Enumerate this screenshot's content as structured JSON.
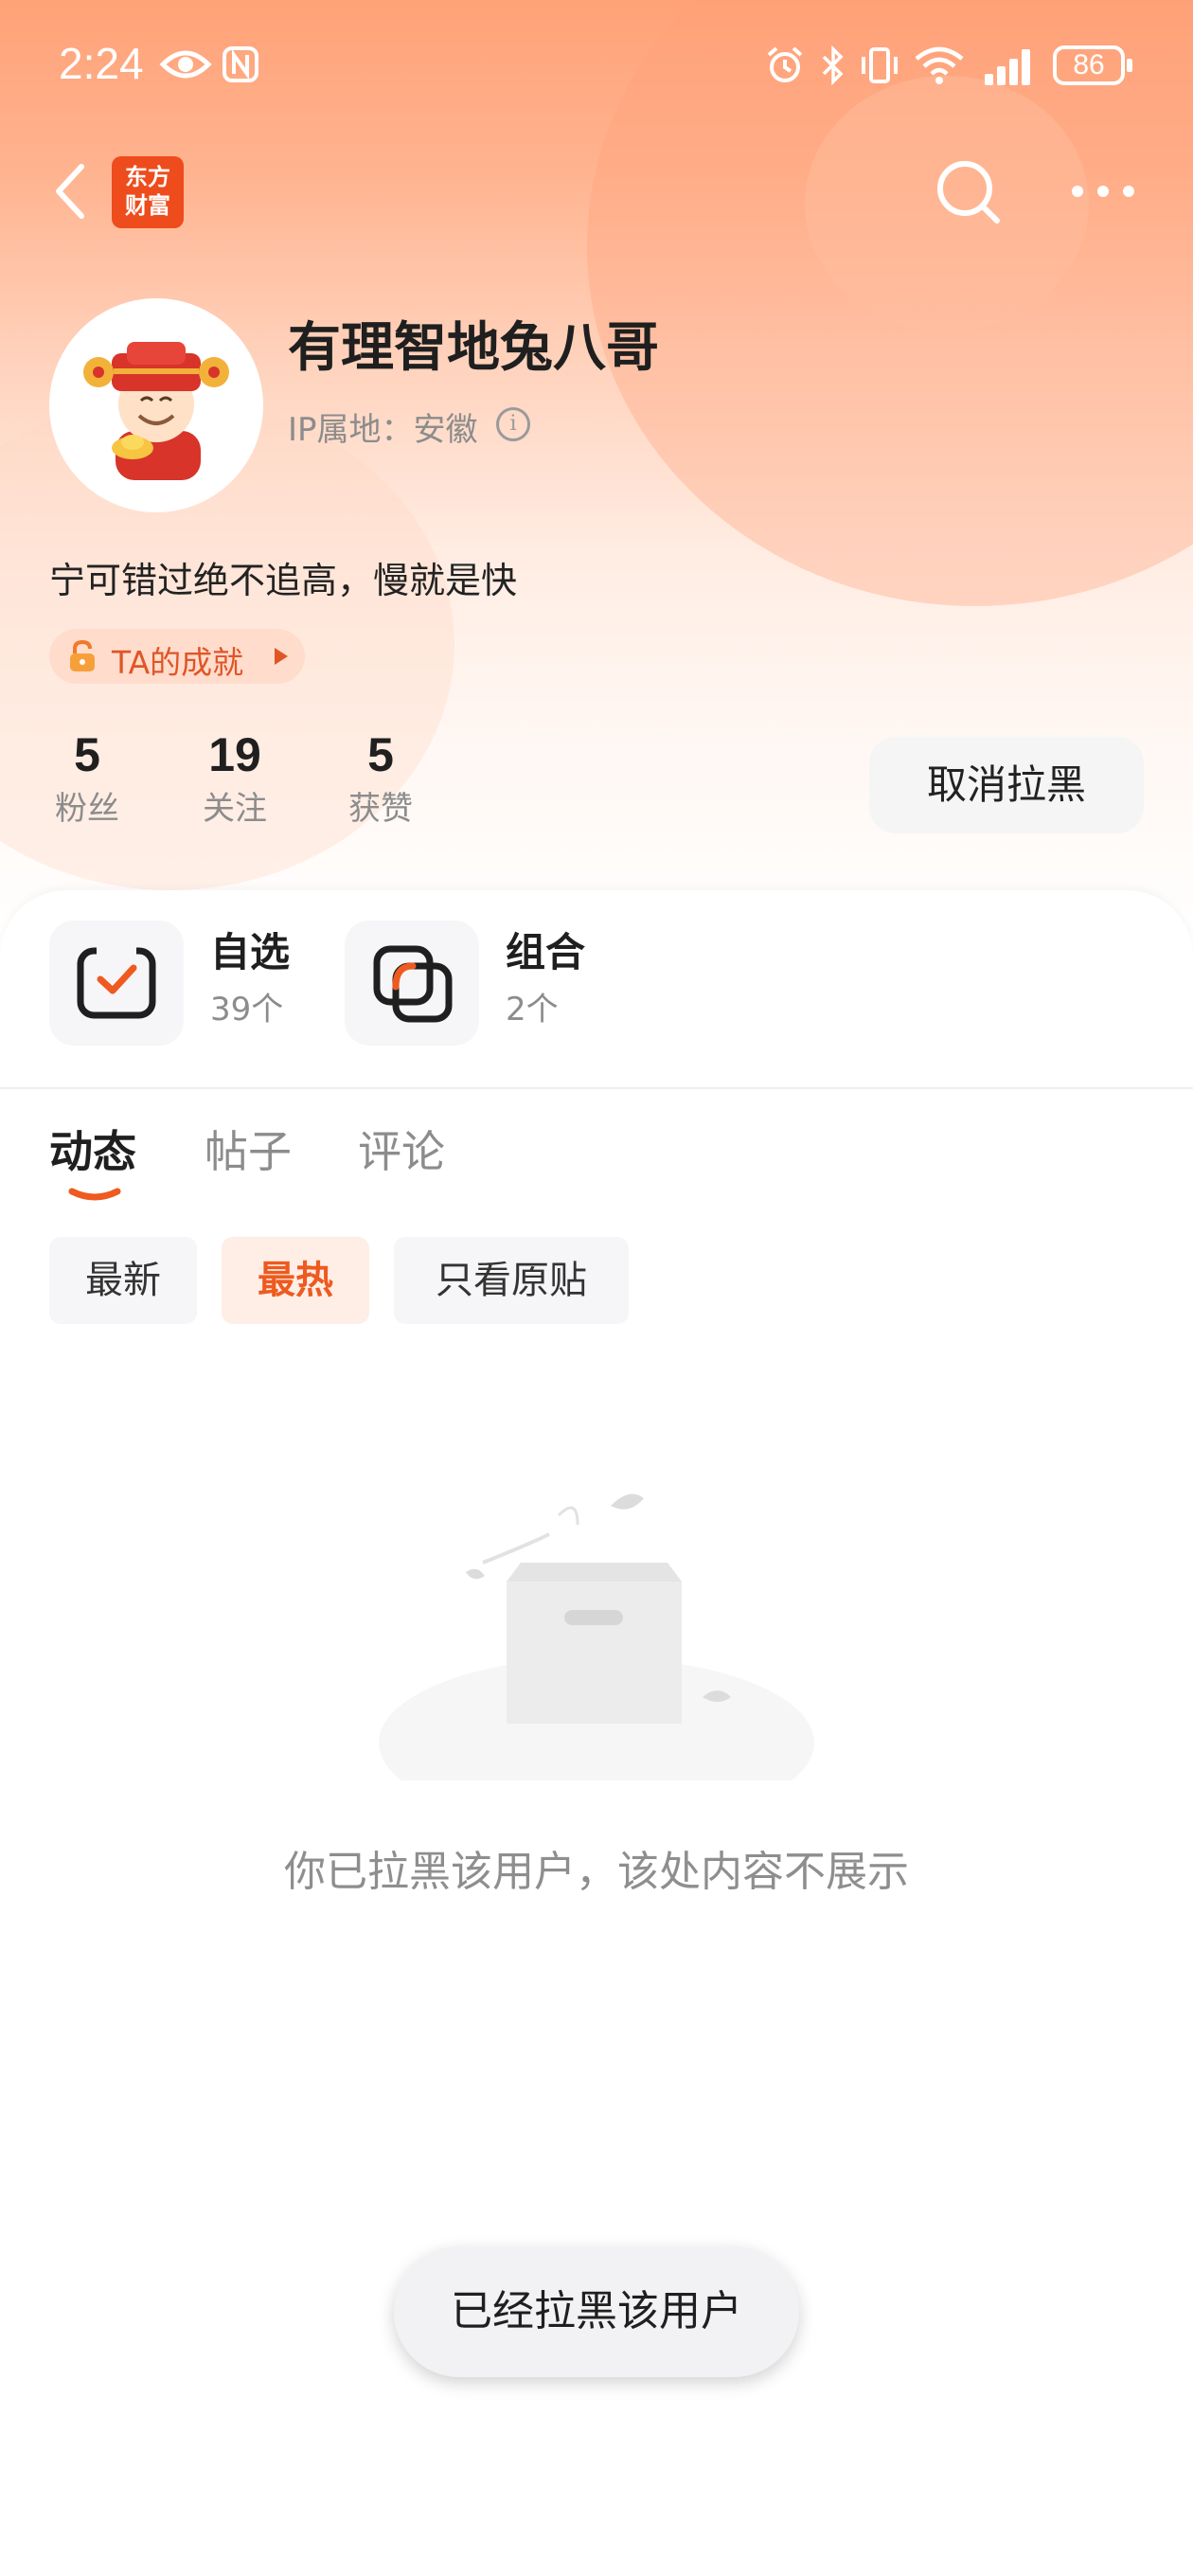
{
  "status_bar": {
    "time": "2:24",
    "battery": "86"
  },
  "nav": {
    "logo_line1": "东方",
    "logo_line2": "财富"
  },
  "profile": {
    "name": "有理智地兔八哥",
    "ip_location": "IP属地：安徽",
    "bio": "宁可错过绝不追高，慢就是快",
    "achievement_label": "TA的成就"
  },
  "stats": [
    {
      "value": "5",
      "label": "粉丝"
    },
    {
      "value": "19",
      "label": "关注"
    },
    {
      "value": "5",
      "label": "获赞"
    }
  ],
  "unblock_button": "取消拉黑",
  "quick_entries": [
    {
      "title": "自选",
      "count": "39个",
      "icon": "watchlist-check-icon"
    },
    {
      "title": "组合",
      "count": "2个",
      "icon": "portfolio-icon"
    }
  ],
  "tabs": [
    {
      "label": "动态",
      "active": true
    },
    {
      "label": "帖子",
      "active": false
    },
    {
      "label": "评论",
      "active": false
    }
  ],
  "filters": [
    {
      "label": "最新",
      "active": false
    },
    {
      "label": "最热",
      "active": true
    },
    {
      "label": "只看原贴",
      "active": false
    }
  ],
  "empty_message": "你已拉黑该用户，该处内容不展示",
  "toast": "已经拉黑该用户",
  "colors": {
    "accent": "#ee5a1f",
    "logo_bg": "#ee4c1c",
    "header_gradient_top": "#ffa278"
  }
}
